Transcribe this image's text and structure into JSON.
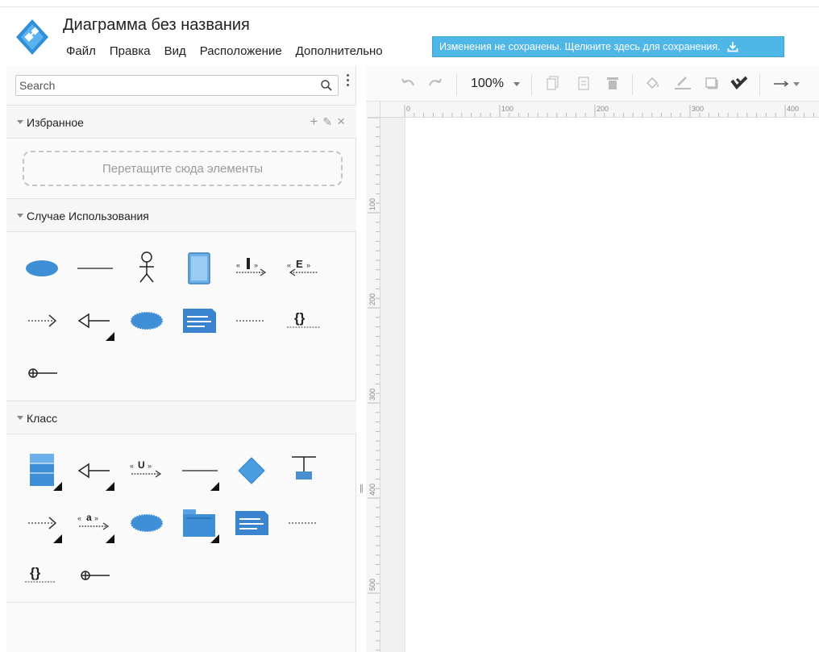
{
  "app": {
    "title": "Диаграмма без названия",
    "menu": [
      "Файл",
      "Правка",
      "Вид",
      "Расположение",
      "Дополнительно"
    ],
    "save_notice": "Изменения не сохранены. Щелкните здесь для сохранения."
  },
  "sidebar": {
    "search_placeholder": "Search",
    "favorites": {
      "label": "Избранное",
      "drop_hint": "Перетащите сюда элементы",
      "actions": [
        "+",
        "✎",
        "×"
      ]
    },
    "use_case": {
      "label": "Случае Использования"
    },
    "class": {
      "label": "Класс"
    }
  },
  "toolbar": {
    "zoom": "100%"
  },
  "ruler": {
    "horizontal": [
      "0",
      "100",
      "200",
      "300",
      "400"
    ],
    "vertical": [
      "100",
      "200",
      "300",
      "400",
      "500"
    ]
  },
  "colors": {
    "accent": "#4fb7e7",
    "shape_blue": "#3f8fd6",
    "shape_dark": "#2b6fb5"
  }
}
